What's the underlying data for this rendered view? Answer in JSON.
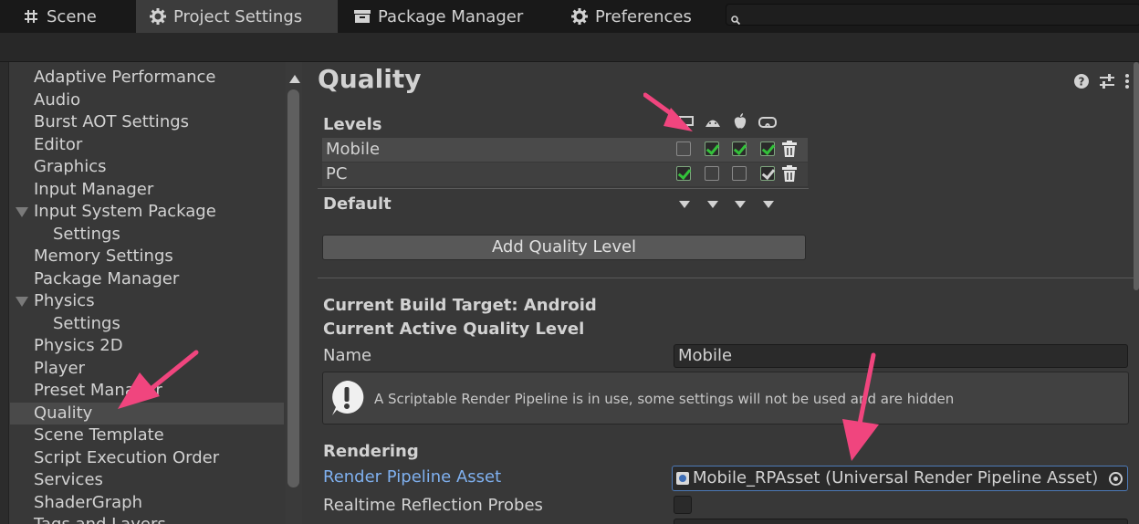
{
  "tabs": [
    {
      "label": "Scene",
      "icon": "grid-icon"
    },
    {
      "label": "Project Settings",
      "icon": "gear-icon",
      "active": true
    },
    {
      "label": "Package Manager",
      "icon": "package-icon"
    },
    {
      "label": "Preferences",
      "icon": "gear-icon"
    }
  ],
  "search": {
    "value": "",
    "placeholder": ""
  },
  "sidebar": {
    "items": [
      {
        "label": "Adaptive Performance"
      },
      {
        "label": "Audio"
      },
      {
        "label": "Burst AOT Settings"
      },
      {
        "label": "Editor"
      },
      {
        "label": "Graphics"
      },
      {
        "label": "Input Manager"
      },
      {
        "label": "Input System Package",
        "expanded": true
      },
      {
        "label": "Settings",
        "child": true
      },
      {
        "label": "Memory Settings"
      },
      {
        "label": "Package Manager"
      },
      {
        "label": "Physics",
        "expanded": true
      },
      {
        "label": "Settings",
        "child": true
      },
      {
        "label": "Physics 2D"
      },
      {
        "label": "Player"
      },
      {
        "label": "Preset Manager"
      },
      {
        "label": "Quality",
        "selected": true
      },
      {
        "label": "Scene Template"
      },
      {
        "label": "Script Execution Order"
      },
      {
        "label": "Services"
      },
      {
        "label": "ShaderGraph"
      },
      {
        "label": "Tags and Layers"
      }
    ]
  },
  "main": {
    "title": "Quality",
    "levels": {
      "header": "Levels",
      "platform_icons": [
        "monitor-icon",
        "android-icon",
        "apple-icon",
        "vr-headset-icon"
      ],
      "rows": [
        {
          "name": "Mobile",
          "checks": [
            false,
            true,
            true,
            true
          ],
          "selected": true
        },
        {
          "name": "PC",
          "checks": [
            true,
            false,
            false,
            true
          ]
        }
      ],
      "default_label": "Default",
      "add_button": "Add Quality Level"
    },
    "build_target": "Current Build Target: Android",
    "active_level_header": "Current Active Quality Level",
    "name_label": "Name",
    "name_value": "Mobile",
    "help_text": "A Scriptable Render Pipeline is in use, some settings will not be used and are hidden",
    "rendering_header": "Rendering",
    "render_pipeline_label": "Render Pipeline Asset",
    "render_pipeline_value": "Mobile_RPAsset (Universal Render Pipeline Asset)",
    "realtime_probes_label": "Realtime Reflection Probes",
    "realtime_probes_value": false
  },
  "colors": {
    "accent_arrow": "#f0457e",
    "check_green": "#33c23a",
    "link_blue": "#7fb0ef",
    "selection_border": "#4d7ab8"
  }
}
